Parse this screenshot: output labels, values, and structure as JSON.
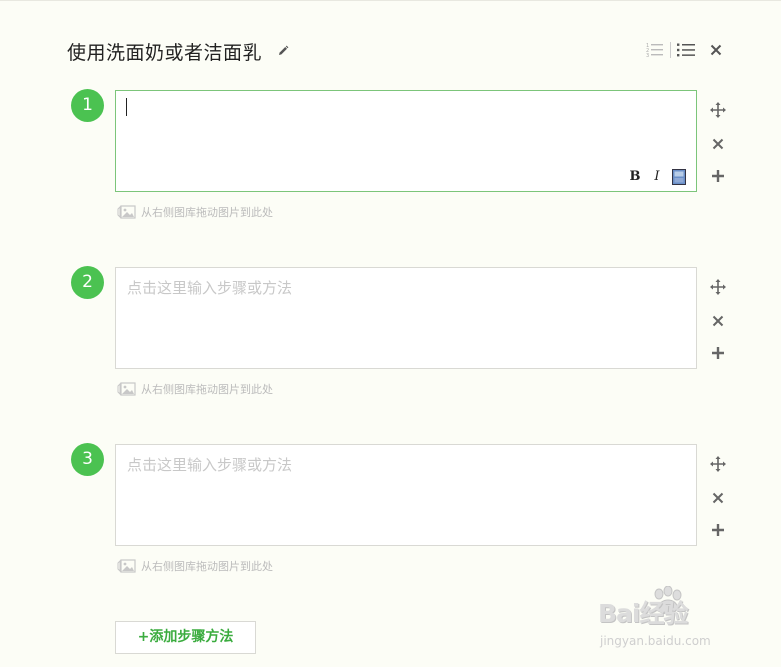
{
  "header": {
    "title": "使用洗面奶或者洁面乳"
  },
  "steps": [
    {
      "number": "1",
      "text": "",
      "placeholder": "",
      "active": true,
      "image_hint": "从右侧图库拖动图片到此处"
    },
    {
      "number": "2",
      "text": "",
      "placeholder": "点击这里输入步骤或方法",
      "active": false,
      "image_hint": "从右侧图库拖动图片到此处"
    },
    {
      "number": "3",
      "text": "",
      "placeholder": "点击这里输入步骤或方法",
      "active": false,
      "image_hint": "从右侧图库拖动图片到此处"
    }
  ],
  "format_toolbar": {
    "bold_label": "B",
    "italic_label": "I"
  },
  "add_step_button": {
    "label": "+添加步骤方法"
  },
  "watermark": {
    "brand": "Bai经验",
    "url": "jingyan.baidu.com"
  },
  "colors": {
    "accent": "#4bc251",
    "active_border": "#7cc57a",
    "add_button_text": "#3bac3f",
    "background": "#fcfdf6"
  },
  "icons": {
    "title_edit": "pencil-icon",
    "toolbar": [
      "numbered-list-icon",
      "bulleted-list-icon",
      "close-icon"
    ],
    "step_side": [
      "move-icon",
      "delete-icon",
      "add-icon"
    ],
    "image_hint": "image-icon",
    "format_image": "insert-image-icon"
  }
}
